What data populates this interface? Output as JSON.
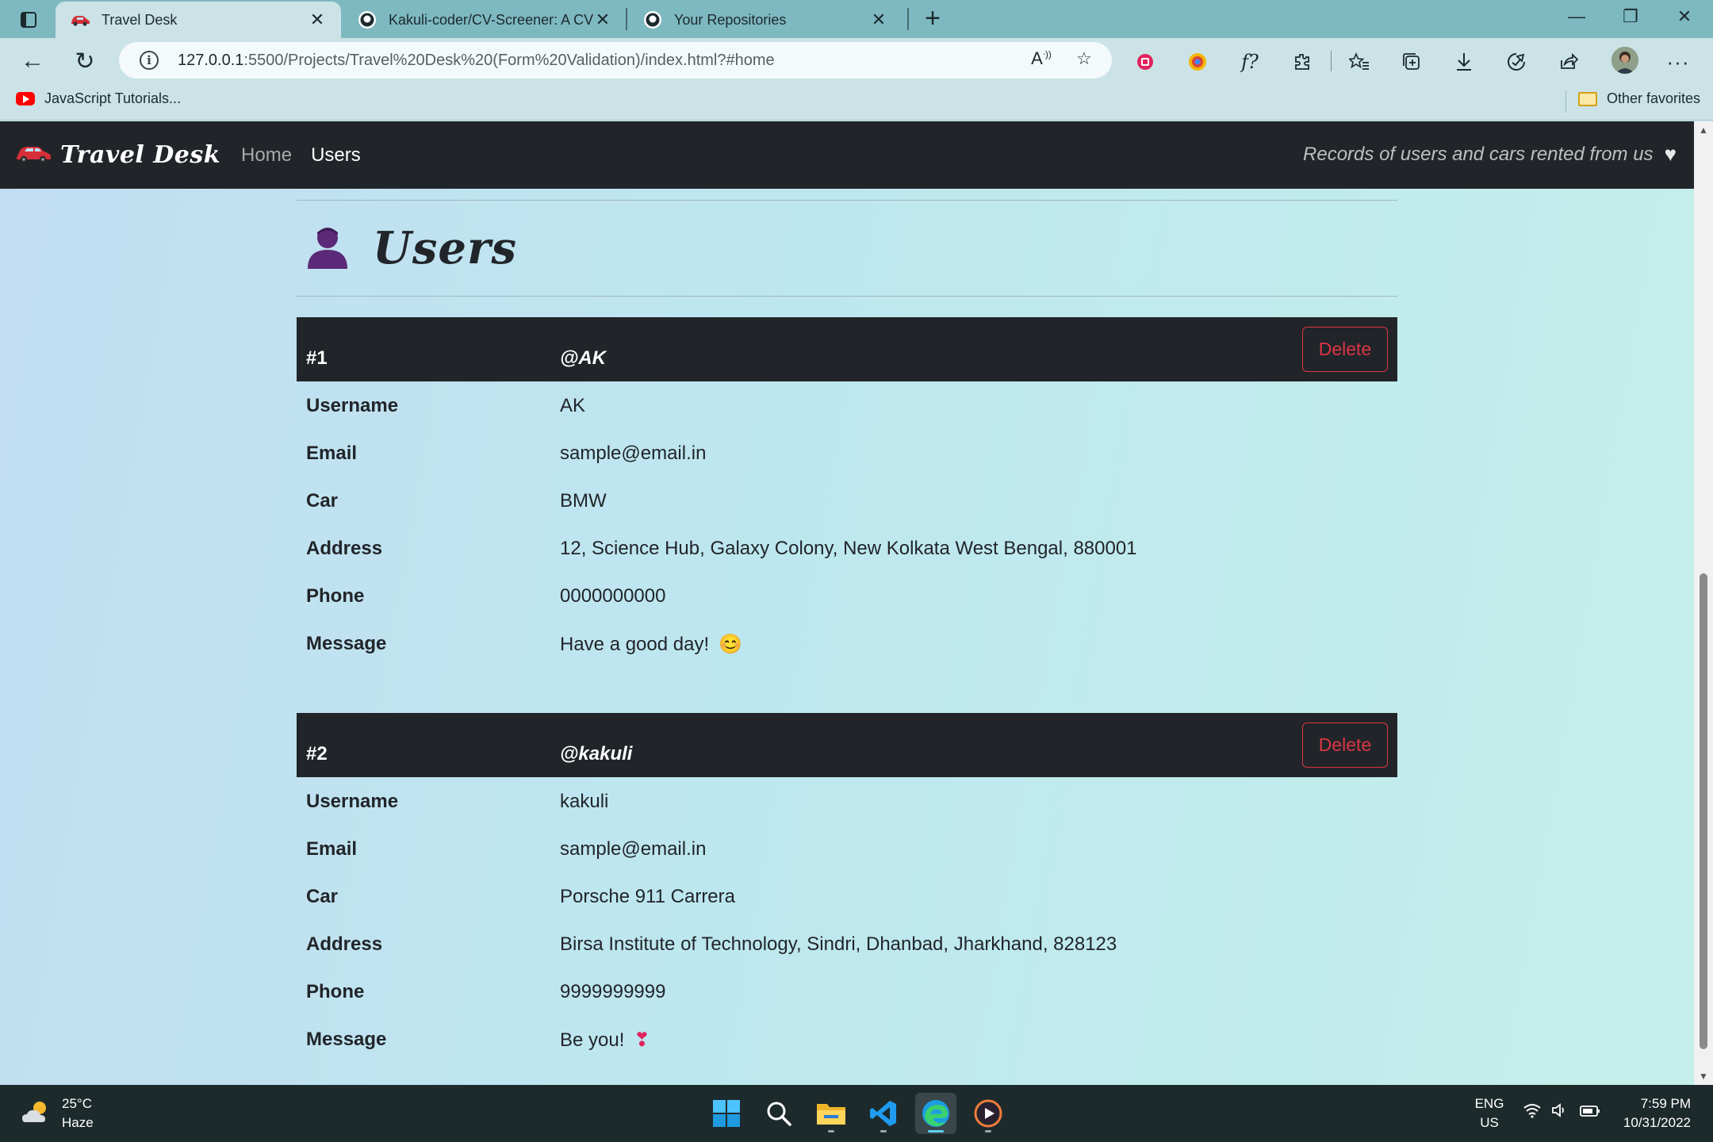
{
  "browser": {
    "tabs": [
      {
        "title": "Travel Desk",
        "active": true
      },
      {
        "title": "Kakuli-coder/CV-Screener: A CV",
        "active": false
      },
      {
        "title": "Your Repositories",
        "active": false
      }
    ],
    "url_host": "127.0.0.1",
    "url_path": ":5500/Projects/Travel%20Desk%20(Form%20Validation)/index.html?#home",
    "favorites": {
      "left": "JavaScript Tutorials...",
      "right": "Other favorites"
    },
    "toolbar_f": "f?"
  },
  "navbar": {
    "brand": "Travel Desk",
    "links": [
      "Home",
      "Users"
    ],
    "tagline": "Records of users and cars rented from us"
  },
  "page": {
    "heading": "Users"
  },
  "labels": {
    "username": "Username",
    "email": "Email",
    "car": "Car",
    "address": "Address",
    "phone": "Phone",
    "message": "Message",
    "delete": "Delete"
  },
  "users": [
    {
      "num": "#1",
      "handle": "@AK",
      "username": "AK",
      "email": "sample@email.in",
      "car": "BMW",
      "address": "12, Science Hub, Galaxy Colony, New Kolkata West Bengal, 880001",
      "phone": "0000000000",
      "message": "Have a good day!",
      "emoji": "😊"
    },
    {
      "num": "#2",
      "handle": "@kakuli",
      "username": "kakuli",
      "email": "sample@email.in",
      "car": "Porsche 911 Carrera",
      "address": "Birsa Institute of Technology, Sindri, Dhanbad, Jharkhand, 828123",
      "phone": "9999999999",
      "message": "Be you!",
      "emoji": "❣"
    }
  ],
  "taskbar": {
    "weather_temp": "25°C",
    "weather_desc": "Haze",
    "lang_top": "ENG",
    "lang_bottom": "US",
    "time": "7:59 PM",
    "date": "10/31/2022"
  }
}
